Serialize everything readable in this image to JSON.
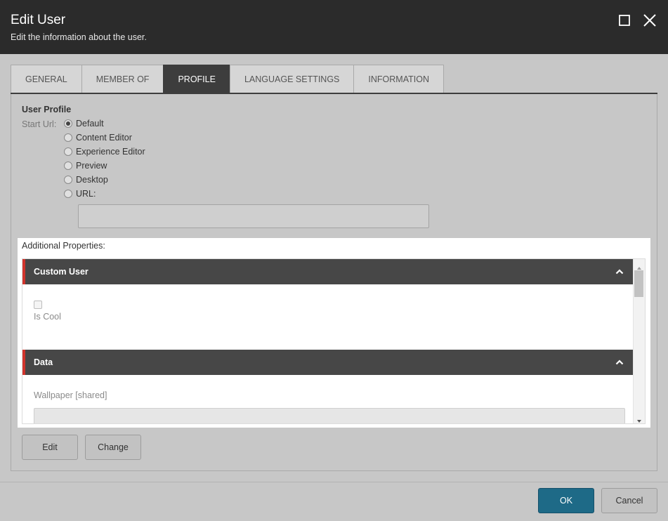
{
  "dialog": {
    "title": "Edit User",
    "subtitle": "Edit the information about the user."
  },
  "tabs": [
    {
      "label": "GENERAL",
      "active": false
    },
    {
      "label": "MEMBER OF",
      "active": false
    },
    {
      "label": "PROFILE",
      "active": true
    },
    {
      "label": "LANGUAGE SETTINGS",
      "active": false
    },
    {
      "label": "INFORMATION",
      "active": false
    }
  ],
  "profile": {
    "section_title": "User Profile",
    "start_url_label": "Start Url:",
    "start_url_options": [
      {
        "label": "Default",
        "checked": true
      },
      {
        "label": "Content Editor",
        "checked": false
      },
      {
        "label": "Experience Editor",
        "checked": false
      },
      {
        "label": "Preview",
        "checked": false
      },
      {
        "label": "Desktop",
        "checked": false
      },
      {
        "label": "URL:",
        "checked": false
      }
    ],
    "url_value": ""
  },
  "additional": {
    "title": "Additional Properties:",
    "sections": [
      {
        "title": "Custom User",
        "fields": [
          {
            "type": "checkbox",
            "label": "Is Cool",
            "checked": false
          }
        ]
      },
      {
        "title": "Data",
        "fields": [
          {
            "type": "text",
            "label": "Wallpaper [shared]",
            "value": ""
          }
        ]
      }
    ]
  },
  "buttons": {
    "edit": "Edit",
    "change": "Change",
    "ok": "OK",
    "cancel": "Cancel"
  },
  "icons": {
    "maximize": "maximize-icon",
    "close": "close-icon",
    "collapse": "chevron-up-icon",
    "scroll_up": "scroll-up-arrow-icon",
    "scroll_down": "scroll-down-arrow-icon"
  },
  "colors": {
    "title_bar": "#2b2b2b",
    "active_tab": "#3d3d3d",
    "section_accent": "#d0342c",
    "ok_button": "#1e6a87"
  }
}
